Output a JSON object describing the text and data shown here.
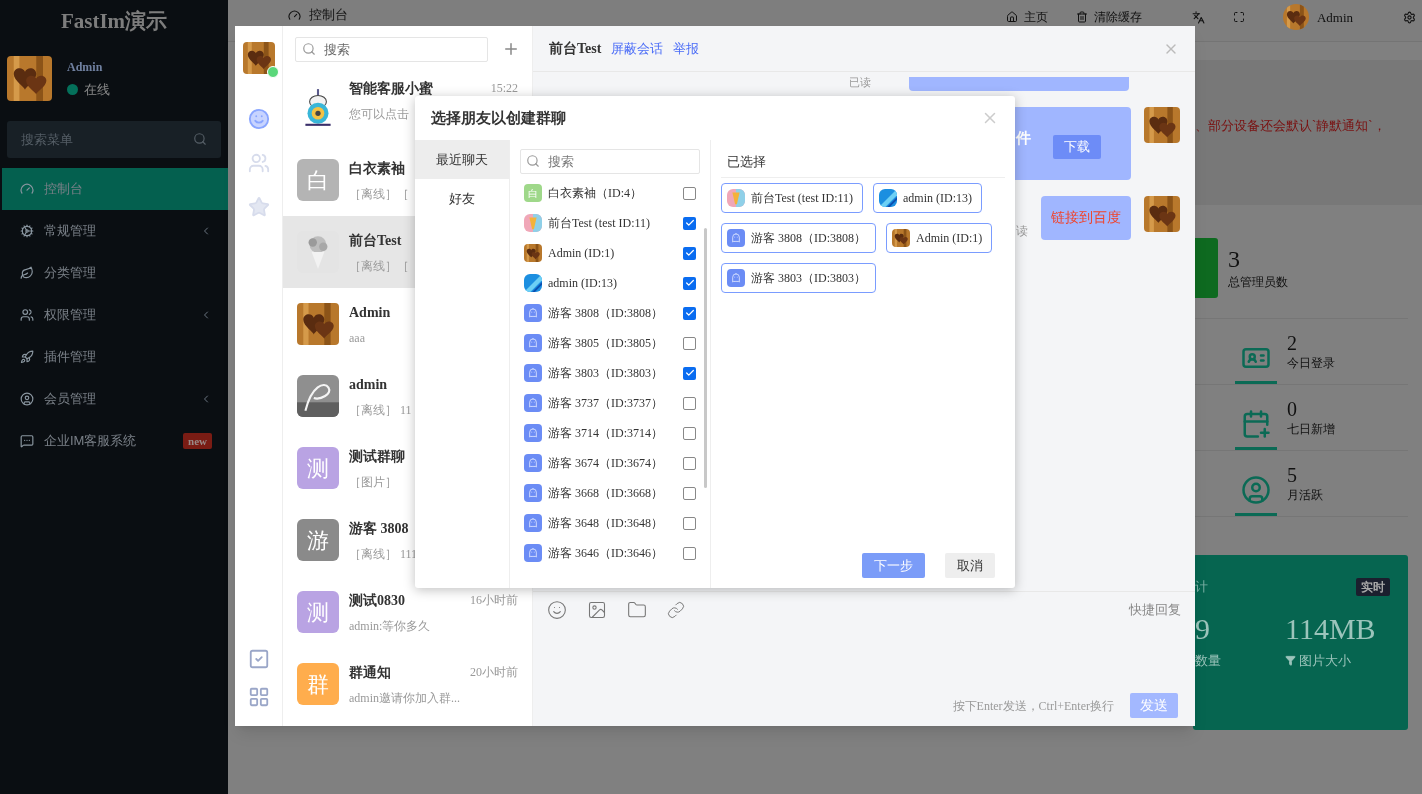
{
  "sidebar": {
    "logo": "FastIm演示",
    "user": {
      "name": "Admin",
      "status": "在线",
      "online": true
    },
    "search": {
      "placeholder": "搜索菜单"
    },
    "menu": [
      {
        "label": "控制台",
        "selected": true,
        "has_submenu": false
      },
      {
        "label": "常规管理",
        "selected": false,
        "has_submenu": true
      },
      {
        "label": "分类管理",
        "selected": false,
        "has_submenu": false
      },
      {
        "label": "权限管理",
        "selected": false,
        "has_submenu": true
      },
      {
        "label": "插件管理",
        "selected": false,
        "has_submenu": false
      },
      {
        "label": "会员管理",
        "selected": false,
        "has_submenu": true
      },
      {
        "label": "企业IM客服系统",
        "selected": false,
        "has_submenu": false,
        "badge": "new"
      }
    ]
  },
  "topbar": {
    "tab": "控制台",
    "links": [
      "主页",
      "清除缓存"
    ],
    "user": "Admin"
  },
  "dashboard": {
    "notice": "、部分设备还会默认`静默通知`，",
    "total": {
      "value": "3",
      "label": "总管理员数"
    },
    "stats": [
      {
        "value": "2",
        "label": "今日登录"
      },
      {
        "value": "0",
        "label": "七日新增"
      },
      {
        "value": "5",
        "label": "月活跃"
      }
    ],
    "card": {
      "title": "计",
      "badge": "实时",
      "metrics": [
        {
          "value": "9",
          "label": "数量"
        },
        {
          "value": "114MB",
          "label": "图片大小"
        }
      ]
    }
  },
  "im": {
    "me": {
      "online": true
    },
    "nav": [
      {
        "selected": true
      },
      {
        "selected": false
      },
      {
        "selected": false
      }
    ],
    "search": {
      "placeholder": "搜索"
    },
    "conversations": [
      {
        "name": "智能客服小蜜",
        "time": "15:22",
        "preview": "您可以点击",
        "selected": false
      },
      {
        "name": "白衣素袖",
        "preview": "［离线］［",
        "avatar": {
          "kind": "letter",
          "text": "白",
          "color": "#b4b4b4"
        },
        "selected": false
      },
      {
        "name": "前台Test",
        "preview": "［离线］［",
        "selected": true
      },
      {
        "name": "Admin",
        "preview": "aaa",
        "selected": false
      },
      {
        "name": "admin",
        "preview": "［离线］ 11",
        "selected": false
      },
      {
        "name": "测试群聊",
        "preview": "［图片］",
        "avatar": {
          "kind": "letter",
          "text": "测",
          "color": "#b9a3e3"
        },
        "selected": false
      },
      {
        "name": "游客 3808",
        "preview": "［离线］ 111",
        "avatar": {
          "kind": "letter",
          "text": "游",
          "color": "#8a8a8a"
        },
        "selected": false
      },
      {
        "name": "测试0830",
        "time": "16小时前",
        "preview": "admin:等你多久",
        "avatar": {
          "kind": "letter",
          "text": "测",
          "color": "#b9a3e3"
        },
        "selected": false
      },
      {
        "name": "群通知",
        "time": "20小时前",
        "preview": "admin邀请你加入群...",
        "avatar": {
          "kind": "letter",
          "text": "群",
          "color": "#ffad4d"
        },
        "selected": false
      }
    ],
    "chat": {
      "title": "前台Test",
      "links": [
        "屏蔽会话",
        "举报"
      ],
      "messages": [
        {
          "kind": "text",
          "status": "已读"
        },
        {
          "kind": "file",
          "text": "件",
          "button": "下载"
        },
        {
          "kind": "link",
          "text": "链接到百度",
          "status": "读"
        }
      ],
      "quick_reply": "快捷回复",
      "hint": "按下Enter发送，Ctrl+Enter换行",
      "send": "发送"
    }
  },
  "dialog": {
    "title": "选择朋友以创建群聊",
    "tabs": [
      {
        "label": "最近聊天",
        "selected": true
      },
      {
        "label": "好友",
        "selected": false
      }
    ],
    "search": {
      "placeholder": "搜索"
    },
    "friends": [
      {
        "name": "白衣素袖（ID:4）",
        "avatar": {
          "kind": "letter",
          "text": "白",
          "color": "#9fd88a"
        },
        "checked": false
      },
      {
        "name": "前台Test (test ID:11)",
        "checked": true
      },
      {
        "name": "Admin (ID:1)",
        "checked": true
      },
      {
        "name": "admin (ID:13)",
        "checked": true
      },
      {
        "name": "游客 3808（ID:3808）",
        "avatar": {
          "kind": "guest"
        },
        "checked": true
      },
      {
        "name": "游客 3805（ID:3805）",
        "avatar": {
          "kind": "guest"
        },
        "checked": false
      },
      {
        "name": "游客 3803（ID:3803）",
        "avatar": {
          "kind": "guest"
        },
        "checked": true
      },
      {
        "name": "游客 3737（ID:3737）",
        "avatar": {
          "kind": "guest"
        },
        "checked": false
      },
      {
        "name": "游客 3714（ID:3714）",
        "avatar": {
          "kind": "guest"
        },
        "checked": false
      },
      {
        "name": "游客 3674（ID:3674）",
        "avatar": {
          "kind": "guest"
        },
        "checked": false
      },
      {
        "name": "游客 3668（ID:3668）",
        "avatar": {
          "kind": "guest"
        },
        "checked": false
      },
      {
        "name": "游客 3648（ID:3648）",
        "avatar": {
          "kind": "guest"
        },
        "checked": false
      },
      {
        "name": "游客 3646（ID:3646）",
        "avatar": {
          "kind": "guest"
        },
        "checked": false
      }
    ],
    "selected_title": "已选择",
    "selected": [
      {
        "name": "前台Test (test ID:11)"
      },
      {
        "name": "admin (ID:13)"
      },
      {
        "name": "游客 3808（ID:3808）",
        "avatar": {
          "kind": "guest"
        }
      },
      {
        "name": "Admin (ID:1)"
      },
      {
        "name": "游客 3803（ID:3803）",
        "avatar": {
          "kind": "guest"
        }
      }
    ],
    "next": "下一步",
    "cancel": "取消"
  }
}
